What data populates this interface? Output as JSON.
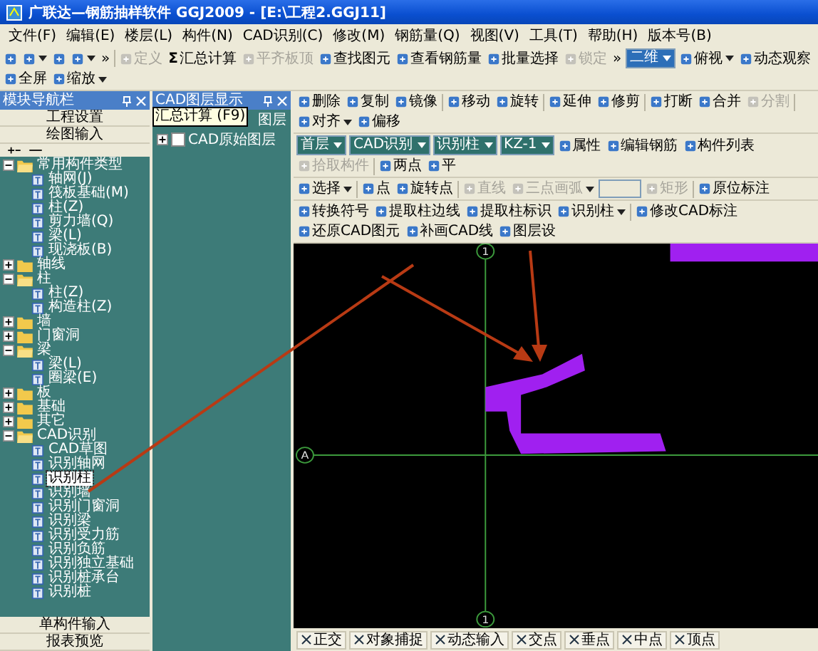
{
  "window": {
    "title": "广联达—钢筋抽样软件 GGJ2009 - [E:\\工程2.GGJ11]"
  },
  "menu": [
    "文件(F)",
    "编辑(E)",
    "楼层(L)",
    "构件(N)",
    "CAD识别(C)",
    "修改(M)",
    "钢筋量(Q)",
    "视图(V)",
    "工具(T)",
    "帮助(H)",
    "版本号(B)"
  ],
  "main_toolbar": [
    {
      "kind": "icon",
      "disabled": false,
      "dropdown": false
    },
    {
      "kind": "icon",
      "disabled": false,
      "dropdown": true
    },
    {
      "kind": "icon",
      "disabled": false,
      "dropdown": false
    },
    {
      "kind": "icon",
      "disabled": false,
      "dropdown": true
    },
    {
      "kind": "text",
      "label": "»",
      "disabled": false,
      "dropdown": false
    },
    {
      "kind": "separator"
    },
    {
      "kind": "button",
      "label": "定义",
      "disabled": true,
      "dropdown": false
    },
    {
      "kind": "button",
      "label": "汇总计算",
      "symbol": "Σ",
      "disabled": false,
      "dropdown": false
    },
    {
      "kind": "button",
      "label": "平齐板顶",
      "disabled": true,
      "dropdown": false
    },
    {
      "kind": "button",
      "label": "查找图元",
      "disabled": false,
      "dropdown": false
    },
    {
      "kind": "button",
      "label": "查看钢筋量",
      "disabled": false,
      "dropdown": false
    },
    {
      "kind": "button",
      "label": "批量选择",
      "disabled": false,
      "dropdown": false
    },
    {
      "kind": "button",
      "label": "锁定",
      "disabled": true,
      "dropdown": false
    },
    {
      "kind": "text",
      "label": "»",
      "disabled": false,
      "dropdown": false
    },
    {
      "kind": "select",
      "label": "二维"
    },
    {
      "kind": "button",
      "label": "俯视",
      "disabled": false,
      "dropdown": true
    },
    {
      "kind": "button",
      "label": "动态观察",
      "disabled": false,
      "dropdown": false
    },
    {
      "kind": "button",
      "label": "全屏",
      "disabled": false,
      "dropdown": false
    },
    {
      "kind": "button",
      "label": "缩放",
      "disabled": false,
      "dropdown": true
    }
  ],
  "navigator": {
    "title": "模块导航栏",
    "sections_top": [
      "工程设置",
      "绘图输入"
    ],
    "tree": [
      {
        "label": "常用构件类型",
        "expanded": true,
        "selected": false,
        "children": [
          {
            "label": "轴网(J)",
            "selected": false
          },
          {
            "label": "筏板基础(M)",
            "selected": false
          },
          {
            "label": "柱(Z)",
            "selected": false
          },
          {
            "label": "剪力墙(Q)",
            "selected": false
          },
          {
            "label": "梁(L)",
            "selected": false
          },
          {
            "label": "现浇板(B)",
            "selected": false
          }
        ]
      },
      {
        "label": "轴线",
        "expanded": false,
        "selected": false
      },
      {
        "label": "柱",
        "expanded": true,
        "selected": false,
        "children": [
          {
            "label": "柱(Z)",
            "selected": false
          },
          {
            "label": "构造柱(Z)",
            "selected": false
          }
        ]
      },
      {
        "label": "墙",
        "expanded": false,
        "selected": false
      },
      {
        "label": "门窗洞",
        "expanded": false,
        "selected": false
      },
      {
        "label": "梁",
        "expanded": true,
        "selected": false,
        "children": [
          {
            "label": "梁(L)",
            "selected": false
          },
          {
            "label": "圈梁(E)",
            "selected": false
          }
        ]
      },
      {
        "label": "板",
        "expanded": false,
        "selected": false
      },
      {
        "label": "基础",
        "expanded": false,
        "selected": false
      },
      {
        "label": "其它",
        "expanded": false,
        "selected": false
      },
      {
        "label": "CAD识别",
        "expanded": true,
        "selected": false,
        "children": [
          {
            "label": "CAD草图",
            "selected": false
          },
          {
            "label": "识别轴网",
            "selected": false
          },
          {
            "label": "识别柱",
            "selected": true
          },
          {
            "label": "识别墙",
            "selected": false
          },
          {
            "label": "识别门窗洞",
            "selected": false
          },
          {
            "label": "识别梁",
            "selected": false
          },
          {
            "label": "识别受力筋",
            "selected": false
          },
          {
            "label": "识别负筋",
            "selected": false
          },
          {
            "label": "识别独立基础",
            "selected": false
          },
          {
            "label": "识别桩承台",
            "selected": false
          },
          {
            "label": "识别桩",
            "selected": false
          }
        ]
      }
    ],
    "sections_bottom": [
      "单构件输入",
      "报表预览"
    ]
  },
  "cad_layers": {
    "title": "CAD图层显示",
    "tooltip": "汇总计算 (F9)",
    "items": [
      {
        "label": "图层"
      },
      {
        "label": "CAD原始图层",
        "checked": false
      }
    ]
  },
  "work_toolbars": [
    {
      "items": [
        {
          "kind": "button",
          "label": "删除",
          "disabled": false,
          "dropdown": false
        },
        {
          "kind": "button",
          "label": "复制",
          "disabled": false,
          "dropdown": false
        },
        {
          "kind": "button",
          "label": "镜像",
          "disabled": false,
          "dropdown": false
        },
        {
          "kind": "separator"
        },
        {
          "kind": "button",
          "label": "移动",
          "disabled": false,
          "dropdown": false
        },
        {
          "kind": "button",
          "label": "旋转",
          "disabled": false,
          "dropdown": false
        },
        {
          "kind": "separator"
        },
        {
          "kind": "button",
          "label": "延伸",
          "disabled": false,
          "dropdown": false
        },
        {
          "kind": "button",
          "label": "修剪",
          "disabled": false,
          "dropdown": false
        },
        {
          "kind": "separator"
        },
        {
          "kind": "button",
          "label": "打断",
          "disabled": false,
          "dropdown": false
        },
        {
          "kind": "button",
          "label": "合并",
          "disabled": false,
          "dropdown": false
        },
        {
          "kind": "button",
          "label": "分割",
          "disabled": true,
          "dropdown": false
        },
        {
          "kind": "separator"
        },
        {
          "kind": "button",
          "label": "对齐",
          "disabled": false,
          "dropdown": true
        },
        {
          "kind": "button",
          "label": "偏移",
          "disabled": false,
          "dropdown": false
        }
      ]
    },
    {
      "items": [
        {
          "kind": "select",
          "label": "首层"
        },
        {
          "kind": "select",
          "label": "CAD识别"
        },
        {
          "kind": "select",
          "label": "识别柱"
        },
        {
          "kind": "select",
          "label": "KZ-1"
        },
        {
          "kind": "button",
          "label": "属性",
          "disabled": false,
          "dropdown": false
        },
        {
          "kind": "button",
          "label": "编辑钢筋",
          "disabled": false,
          "dropdown": false
        },
        {
          "kind": "button",
          "label": "构件列表",
          "disabled": false,
          "dropdown": false
        },
        {
          "kind": "button",
          "label": "拾取构件",
          "disabled": true,
          "dropdown": false
        },
        {
          "kind": "separator"
        },
        {
          "kind": "button",
          "label": "两点",
          "disabled": false,
          "dropdown": false
        },
        {
          "kind": "button",
          "label": "平",
          "disabled": false,
          "dropdown": false
        }
      ]
    },
    {
      "items": [
        {
          "kind": "button",
          "label": "选择",
          "disabled": false,
          "dropdown": true
        },
        {
          "kind": "separator"
        },
        {
          "kind": "button",
          "label": "点",
          "disabled": false,
          "dropdown": false
        },
        {
          "kind": "button",
          "label": "旋转点",
          "disabled": false,
          "dropdown": false
        },
        {
          "kind": "separator"
        },
        {
          "kind": "button",
          "label": "直线",
          "disabled": true,
          "dropdown": false
        },
        {
          "kind": "button",
          "label": "三点画弧",
          "disabled": true,
          "dropdown": true
        },
        {
          "kind": "input",
          "disabled": true
        },
        {
          "kind": "button",
          "label": "矩形",
          "disabled": true,
          "dropdown": false
        },
        {
          "kind": "separator"
        },
        {
          "kind": "button",
          "label": "原位标注",
          "disabled": false,
          "dropdown": false
        }
      ]
    },
    {
      "items": [
        {
          "kind": "button",
          "label": "转换符号",
          "disabled": false,
          "dropdown": false
        },
        {
          "kind": "button",
          "label": "提取柱边线",
          "disabled": false,
          "dropdown": false
        },
        {
          "kind": "button",
          "label": "提取柱标识",
          "disabled": false,
          "dropdown": false
        },
        {
          "kind": "button",
          "label": "识别柱",
          "disabled": false,
          "dropdown": true
        },
        {
          "kind": "separator"
        },
        {
          "kind": "button",
          "label": "修改CAD标注",
          "disabled": false,
          "dropdown": false
        },
        {
          "kind": "button",
          "label": "还原CAD图元",
          "disabled": false,
          "dropdown": false
        },
        {
          "kind": "button",
          "label": "补画CAD线",
          "disabled": false,
          "dropdown": false
        },
        {
          "kind": "button",
          "label": "图层设",
          "disabled": false,
          "dropdown": false
        }
      ]
    }
  ],
  "canvas": {
    "axis_labels": [
      "1",
      "A",
      "1"
    ]
  },
  "status_bar": [
    "正交",
    "对象捕捉",
    "动态输入",
    "交点",
    "垂点",
    "中点",
    "顶点"
  ]
}
